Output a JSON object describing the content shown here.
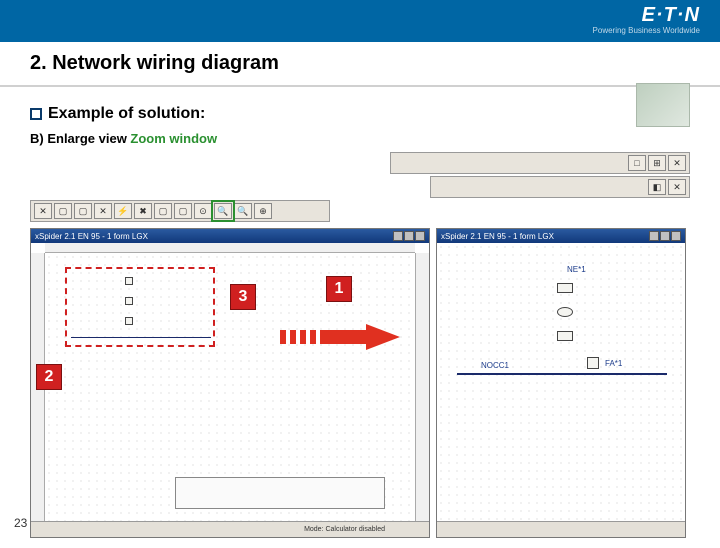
{
  "header": {
    "logo": "E·T·N",
    "tagline": "Powering Business Worldwide"
  },
  "title": "2. Network wiring diagram",
  "bullet": "Example of solution:",
  "subline_prefix": "B) Enlarge view ",
  "subline_green": "Zoom window",
  "toolbar": {
    "row1_btns": [
      "□",
      "⊞",
      "✕"
    ],
    "row2_btns": [
      "◧",
      "✕"
    ],
    "row3_btns": [
      "✕",
      "▢",
      "▢",
      "✕",
      "⚡",
      "✖",
      "▢",
      "▢",
      "⊙",
      "🔍",
      "🔍",
      "⊕"
    ],
    "zoom_window_idx": 9
  },
  "panes": {
    "left": {
      "title": "xSpider 2.1 EN  95 - 1 form LGX",
      "status": [
        "",
        "",
        "",
        "Mode: Calculator disabled",
        ""
      ]
    },
    "right": {
      "title": "xSpider 2.1 EN  95 - 1 form LGX",
      "labels": {
        "ne1": "NE*1",
        "nocc": "NOCC1",
        "fa1": "FA*1"
      }
    }
  },
  "callouts": {
    "one": "1",
    "two": "2",
    "three": "3"
  },
  "page": "23"
}
